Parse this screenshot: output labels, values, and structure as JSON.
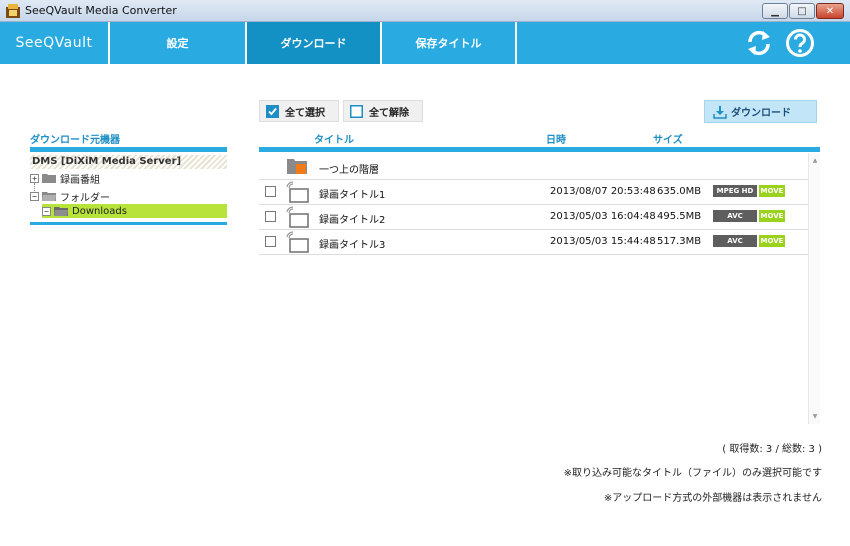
{
  "window": {
    "title": "SeeQVault Media Converter",
    "controls": {
      "minimize": "▁",
      "maximize": "□",
      "close": "✕"
    }
  },
  "nav": {
    "logo": "SeeQVault",
    "tabs": [
      {
        "label": "設定",
        "active": false
      },
      {
        "label": "ダウンロード",
        "active": true
      },
      {
        "label": "保存タイトル",
        "active": false
      }
    ],
    "icons": [
      "refresh-icon",
      "help-icon"
    ]
  },
  "toolbar": {
    "select_all": "全て選択",
    "deselect_all": "全て解除",
    "download": "ダウンロード"
  },
  "source_panel": {
    "title": "ダウンロード元機器",
    "server": "DMS [DiXiM Media Server]",
    "tree": [
      {
        "label": "録画番組",
        "expander": "+",
        "level": 1,
        "selected": false
      },
      {
        "label": "フォルダー",
        "expander": "−",
        "level": 1,
        "selected": false
      },
      {
        "label": "Downloads",
        "expander": "−",
        "level": 2,
        "selected": true
      }
    ]
  },
  "table": {
    "columns": {
      "title": "タイトル",
      "date": "日時",
      "size": "サイズ"
    },
    "parent_folder": "一つ上の階層",
    "rows": [
      {
        "title": "録画タイトル1",
        "date": "2013/08/07 20:53:48",
        "size": "635.0MB",
        "codec": "MPEG HD",
        "move": "MOVE"
      },
      {
        "title": "録画タイトル2",
        "date": "2013/05/03 16:04:48",
        "size": "495.5MB",
        "codec": "AVC",
        "move": "MOVE"
      },
      {
        "title": "録画タイトル3",
        "date": "2013/05/03 15:44:48",
        "size": "517.3MB",
        "codec": "AVC",
        "move": "MOVE"
      }
    ]
  },
  "footer": {
    "count": "( 取得数: 3 / 総数: 3 )",
    "note1": "※取り込み可能なタイトル（ファイル）のみ選択可能です",
    "note2": "※アップロード方式の外部機器は表示されません"
  },
  "colors": {
    "accent": "#29abe2",
    "active_tab": "#1390c4",
    "selected": "#b7e33a",
    "move_badge": "#9bd21e",
    "codec_badge": "#5e5e5e"
  }
}
